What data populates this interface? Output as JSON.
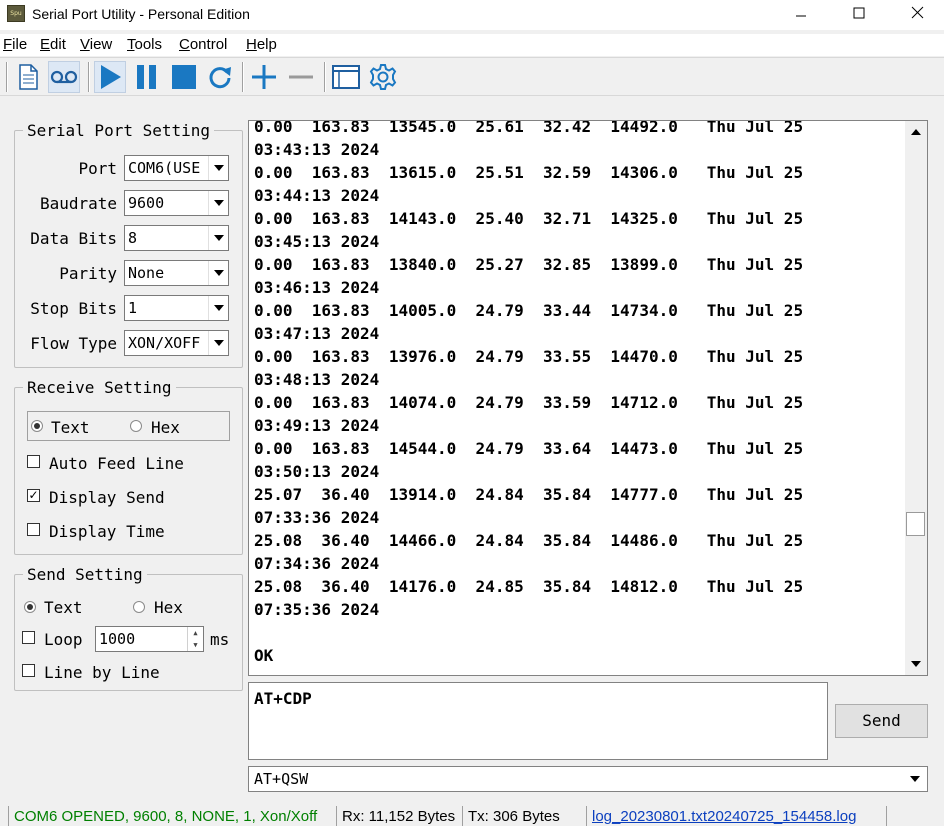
{
  "window": {
    "title": "Serial Port Utility - Personal Edition",
    "icon_text": "Spu"
  },
  "menu": [
    {
      "label": "File",
      "accel": "F",
      "rest": "ile"
    },
    {
      "label": "Edit",
      "accel": "E",
      "rest": "dit"
    },
    {
      "label": "View",
      "accel": "V",
      "rest": "iew"
    },
    {
      "label": "Tools",
      "accel": "T",
      "rest": "ools"
    },
    {
      "label": "Control",
      "accel": "C",
      "rest": "ontrol"
    },
    {
      "label": "Help",
      "accel": "H",
      "rest": "elp"
    }
  ],
  "toolbar": {
    "icons": [
      "new-document-icon",
      "record-icon",
      "play-icon",
      "pause-icon",
      "stop-icon",
      "refresh-icon",
      "add-icon",
      "remove-icon",
      "window-icon",
      "settings-gear-icon"
    ],
    "accent_color": "#1a78c2"
  },
  "serial_port_setting": {
    "legend": "Serial Port Setting",
    "fields": [
      {
        "label": "Port",
        "value": "COM6(USE"
      },
      {
        "label": "Baudrate",
        "value": "9600"
      },
      {
        "label": "Data Bits",
        "value": "8"
      },
      {
        "label": "Parity",
        "value": "None"
      },
      {
        "label": "Stop Bits",
        "value": "1"
      },
      {
        "label": "Flow Type",
        "value": "XON/XOFF"
      }
    ]
  },
  "receive_setting": {
    "legend": "Receive Setting",
    "mode_text": "Text",
    "mode_hex": "Hex",
    "selected_mode": "Text",
    "auto_feed_line": {
      "label": "Auto Feed Line",
      "checked": false
    },
    "display_send": {
      "label": "Display Send",
      "checked": true
    },
    "display_time": {
      "label": "Display Time",
      "checked": false
    }
  },
  "send_setting": {
    "legend": "Send Setting",
    "mode_text": "Text",
    "mode_hex": "Hex",
    "selected_mode": "Text",
    "loop": {
      "label": "Loop",
      "checked": false,
      "interval": "1000",
      "unit": "ms"
    },
    "line_by_line": {
      "label": "Line by Line",
      "checked": false
    }
  },
  "output_lines": [
    "0.00  163.83  13545.0  25.61  32.42  14492.0   Thu Jul 25",
    "03:43:13 2024",
    "0.00  163.83  13615.0  25.51  32.59  14306.0   Thu Jul 25",
    "03:44:13 2024",
    "0.00  163.83  14143.0  25.40  32.71  14325.0   Thu Jul 25",
    "03:45:13 2024",
    "0.00  163.83  13840.0  25.27  32.85  13899.0   Thu Jul 25",
    "03:46:13 2024",
    "0.00  163.83  14005.0  24.79  33.44  14734.0   Thu Jul 25",
    "03:47:13 2024",
    "0.00  163.83  13976.0  24.79  33.55  14470.0   Thu Jul 25",
    "03:48:13 2024",
    "0.00  163.83  14074.0  24.79  33.59  14712.0   Thu Jul 25",
    "03:49:13 2024",
    "0.00  163.83  14544.0  24.79  33.64  14473.0   Thu Jul 25",
    "03:50:13 2024",
    "25.07  36.40  13914.0  24.84  35.84  14777.0   Thu Jul 25",
    "07:33:36 2024",
    "25.08  36.40  14466.0  24.84  35.84  14486.0   Thu Jul 25",
    "07:34:36 2024",
    "25.08  36.40  14176.0  24.85  35.84  14812.0   Thu Jul 25",
    "07:35:36 2024",
    "",
    "OK"
  ],
  "send_input": {
    "value": "AT+CDP"
  },
  "send_button": {
    "label": "Send"
  },
  "command_combo": {
    "value": "AT+QSW"
  },
  "status": {
    "connection": "COM6 OPENED, 9600, 8, NONE, 1, Xon/Xoff",
    "connection_color": "#008000",
    "rx": "Rx: 11,152 Bytes",
    "tx": "Tx: 306 Bytes",
    "log_file": "log_20230801.txt20240725_154458.log"
  }
}
